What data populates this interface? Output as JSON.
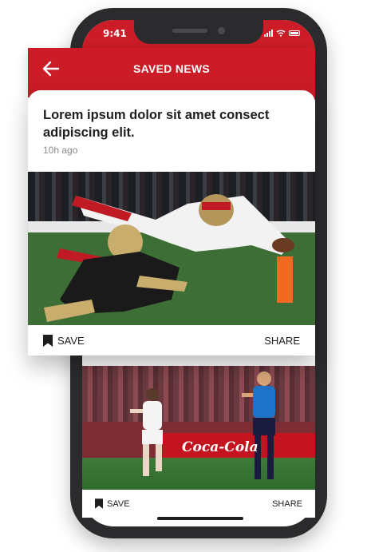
{
  "status_bar": {
    "time": "9:41",
    "icons": [
      "signal-icon",
      "wifi-icon",
      "battery-icon"
    ]
  },
  "header": {
    "title": "SAVED NEWS",
    "back_icon": "arrow-left-icon",
    "color": "#cb1c27"
  },
  "featured_article": {
    "headline": "Lorem ipsum dolor sit amet consect adipiscing elit.",
    "time_ago": "10h ago",
    "image": "american-football-tackle-photo",
    "save_label": "SAVE",
    "share_label": "SHARE",
    "save_icon": "bookmark-icon"
  },
  "second_article": {
    "image": "womens-soccer-match-photo",
    "banner_text": "Coca-Cola",
    "save_label": "SAVE",
    "share_label": "SHARE",
    "save_icon": "bookmark-icon"
  },
  "colors": {
    "accent": "#cb1c27",
    "phone_frame": "#2b2b2e",
    "text": "#1e1e1e",
    "muted": "#8a8a8a"
  }
}
